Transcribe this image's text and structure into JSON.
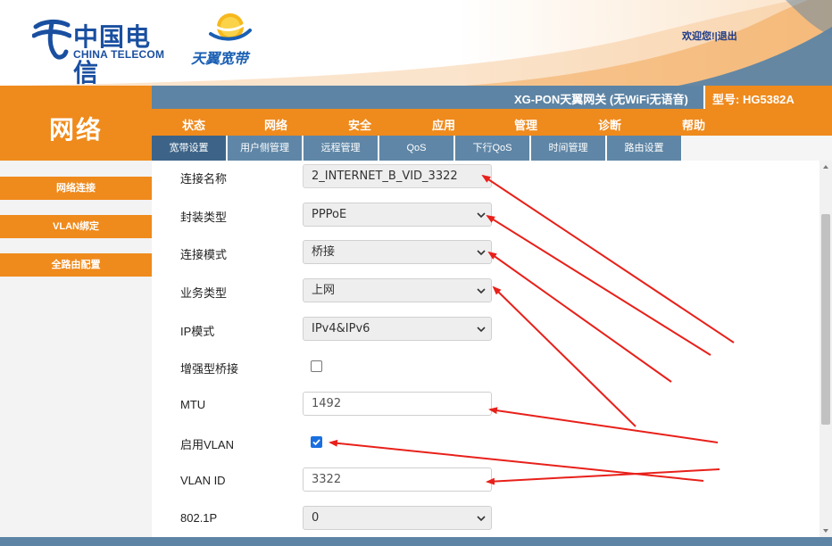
{
  "brand": {
    "telecom_cn": "中国电信",
    "telecom_en": "CHINA TELECOM",
    "tianyi": "天翼宽带"
  },
  "user": {
    "welcome": "欢迎您!",
    "logout": "退出"
  },
  "section_title": "网络",
  "product": {
    "name": "XG-PON天翼网关 (无WiFi无语音)",
    "model": "型号: HG5382A"
  },
  "nav": {
    "items": [
      {
        "label": "状态"
      },
      {
        "label": "网络"
      },
      {
        "label": "安全"
      },
      {
        "label": "应用"
      },
      {
        "label": "管理"
      },
      {
        "label": "诊断"
      },
      {
        "label": "帮助"
      }
    ]
  },
  "subnav": {
    "tabs": [
      {
        "label": "宽带设置"
      },
      {
        "label": "用户侧管理"
      },
      {
        "label": "远程管理"
      },
      {
        "label": "QoS"
      },
      {
        "label": "下行QoS"
      },
      {
        "label": "时间管理"
      },
      {
        "label": "路由设置"
      }
    ]
  },
  "sidebar": {
    "items": [
      {
        "label": "网络连接"
      },
      {
        "label": "VLAN绑定"
      },
      {
        "label": "全路由配置"
      }
    ]
  },
  "form": {
    "connection_name": {
      "label": "连接名称",
      "value": "2_INTERNET_B_VID_3322"
    },
    "encapsulation": {
      "label": "封装类型",
      "value": "PPPoE"
    },
    "connection_mode": {
      "label": "连接模式",
      "value": "桥接"
    },
    "service_type": {
      "label": "业务类型",
      "value": "上网"
    },
    "ip_mode": {
      "label": "IP模式",
      "value": "IPv4&IPv6"
    },
    "enhanced_bridge": {
      "label": "增强型桥接",
      "checked": false
    },
    "mtu": {
      "label": "MTU",
      "value": "1492"
    },
    "enable_vlan": {
      "label": "启用VLAN",
      "checked": true
    },
    "vlan_id": {
      "label": "VLAN ID",
      "value": "3322"
    },
    "dot1p": {
      "label": "802.1P",
      "value": "0"
    }
  },
  "colors": {
    "orange": "#ef8a1c",
    "steel_blue": "#5d84a4",
    "active_tab": "#3d6488",
    "brand_blue": "#1a4fa0",
    "checkbox_blue": "#1a6fe0",
    "annotation_red": "#e8201a"
  }
}
